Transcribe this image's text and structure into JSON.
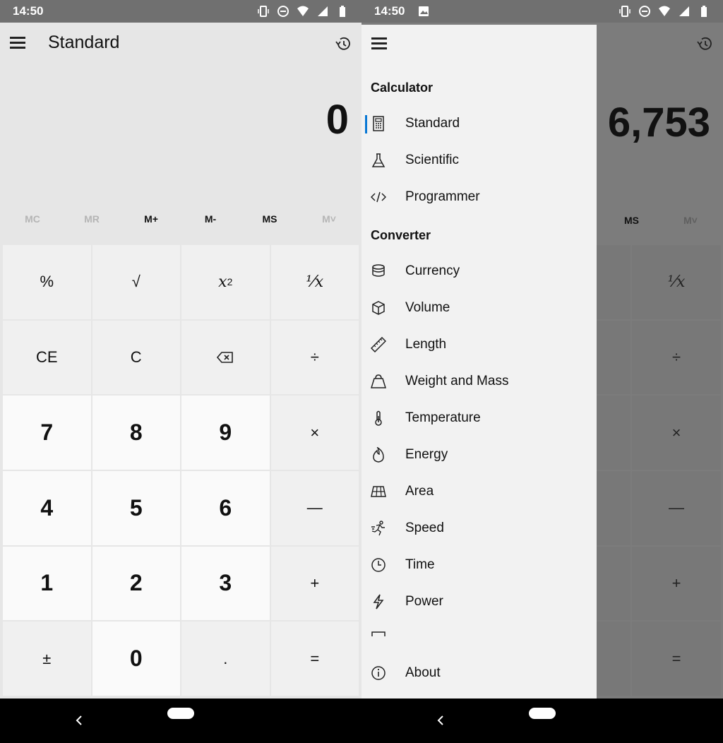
{
  "status_left": {
    "time": "14:50"
  },
  "status_right": {
    "time": "14:50"
  },
  "calculator": {
    "mode_title": "Standard",
    "display_value": "0",
    "memory": [
      "MC",
      "MR",
      "M+",
      "M-",
      "MS",
      "M˅"
    ],
    "keys": {
      "percent": "%",
      "sqrt": "√",
      "square_base": "x",
      "square_exp": "2",
      "reciprocal": "¹⁄x",
      "ce": "CE",
      "c": "C",
      "divide": "÷",
      "seven": "7",
      "eight": "8",
      "nine": "9",
      "multiply": "×",
      "four": "4",
      "five": "5",
      "six": "6",
      "minus": "—",
      "one": "1",
      "two": "2",
      "three": "3",
      "plus": "+",
      "negate": "±",
      "zero": "0",
      "decimal": ".",
      "equals": "="
    }
  },
  "background_app": {
    "display_value": "6,753",
    "ms": "MS",
    "mlist": "M˅"
  },
  "drawer": {
    "calculator_title": "Calculator",
    "converter_title": "Converter",
    "items": {
      "standard": "Standard",
      "scientific": "Scientific",
      "programmer": "Programmer",
      "currency": "Currency",
      "volume": "Volume",
      "length": "Length",
      "weight": "Weight and Mass",
      "temperature": "Temperature",
      "energy": "Energy",
      "area": "Area",
      "speed": "Speed",
      "time": "Time",
      "power": "Power",
      "about": "About"
    }
  }
}
